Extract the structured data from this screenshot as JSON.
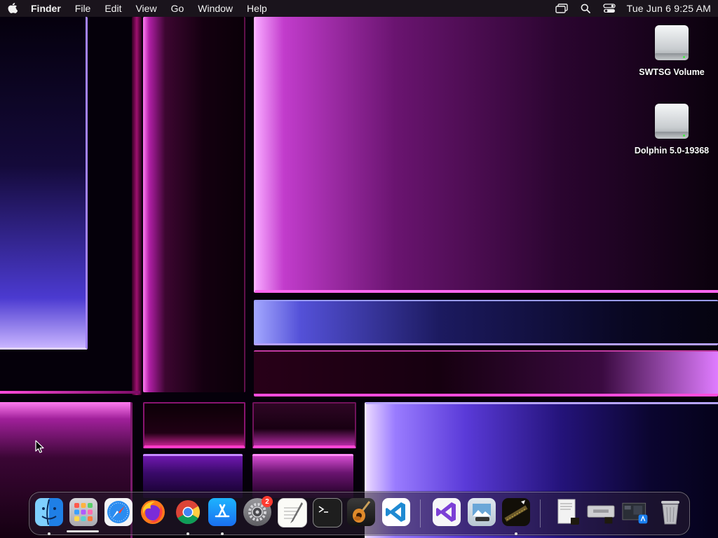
{
  "menubar": {
    "app_name": "Finder",
    "menus": [
      "File",
      "Edit",
      "View",
      "Go",
      "Window",
      "Help"
    ],
    "status_icons": [
      "screen-mirroring-icon",
      "search-icon",
      "control-center-icon"
    ],
    "clock": "Tue Jun 6  9:25 AM"
  },
  "desktop": {
    "icons": [
      {
        "label": "SWTSG Volume",
        "icon": "external-drive-icon"
      },
      {
        "label": "Dolphin 5.0-19368",
        "icon": "external-drive-icon"
      }
    ]
  },
  "dock": {
    "apps": [
      {
        "name": "Finder",
        "icon": "finder-icon",
        "running": true
      },
      {
        "name": "Launchpad",
        "icon": "launchpad-icon",
        "running": false
      },
      {
        "name": "Safari",
        "icon": "safari-icon",
        "running": false
      },
      {
        "name": "Firefox",
        "icon": "firefox-icon",
        "running": false
      },
      {
        "name": "Google Chrome",
        "icon": "chrome-icon",
        "running": true
      },
      {
        "name": "App Store",
        "icon": "app-store-icon",
        "running": true
      },
      {
        "name": "System Preferences",
        "icon": "system-preferences-icon",
        "running": false,
        "badge": "2"
      },
      {
        "name": "TextEdit",
        "icon": "textedit-icon",
        "running": false
      },
      {
        "name": "Terminal",
        "icon": "terminal-icon",
        "running": false
      },
      {
        "name": "GarageBand",
        "icon": "garageband-icon",
        "running": false
      },
      {
        "name": "Visual Studio Code",
        "icon": "vscode-icon",
        "running": false
      },
      {
        "name": "Visual Studio",
        "icon": "visual-studio-icon",
        "running": false
      },
      {
        "name": "Preview",
        "icon": "preview-icon",
        "running": false
      },
      {
        "name": "Dolphin",
        "icon": "dolphin-icon",
        "running": true
      }
    ],
    "stacks": [
      {
        "name": "Document stack",
        "icon": "document-stack-icon"
      },
      {
        "name": "Drive image stack",
        "icon": "drive-stack-icon"
      },
      {
        "name": "Downloads stack",
        "icon": "downloads-stack-icon"
      },
      {
        "name": "Trash",
        "icon": "trash-icon"
      }
    ]
  }
}
